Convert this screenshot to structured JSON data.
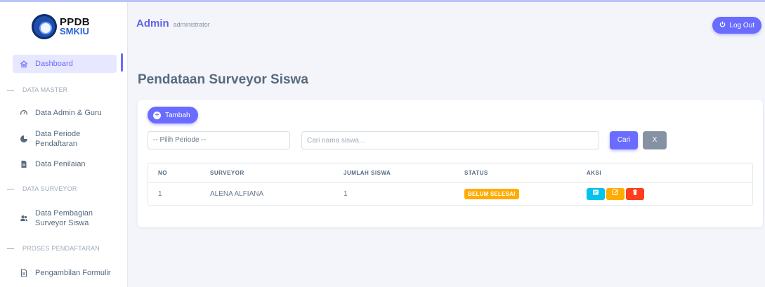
{
  "sidebar": {
    "logo": {
      "line1": "PPDB",
      "line2": "SMKIU"
    },
    "dashboard": {
      "label": "Dashboard",
      "icon": "home-icon"
    },
    "sections": [
      {
        "title": "DATA MASTER"
      },
      {
        "title": "DATA SURVEYOR"
      },
      {
        "title": "PROSES PENDAFTARAN"
      }
    ],
    "items": [
      {
        "label": "Data Admin & Guru",
        "icon": "gauge-icon"
      },
      {
        "label": "Data Periode Pendaftaran",
        "icon": "pie-icon"
      },
      {
        "label": "Data Penilaian",
        "icon": "document-icon"
      },
      {
        "label": "Data Pembagian Surveyor Siswa",
        "icon": "users-icon"
      },
      {
        "label": "Pengambilan Formulir",
        "icon": "file-icon"
      }
    ]
  },
  "topbar": {
    "title": "Admin",
    "role": "administrator",
    "logout_label": "Log Out"
  },
  "page": {
    "title": "Pendataan Surveyor Siswa"
  },
  "toolbar": {
    "add_label": "Tambah",
    "period_select": "-- Pilih Periode --",
    "search_placeholder": "Cari nama siswa...",
    "search_label": "Cari",
    "clear_label": "X"
  },
  "table": {
    "headers": [
      "NO",
      "SURVEYOR",
      "JUMLAH SISWA",
      "STATUS",
      "AKSI"
    ],
    "rows": [
      {
        "no": "1",
        "surveyor": "ALENA ALFIANA",
        "jumlah": "1",
        "status": "BELUM SELESAI"
      }
    ]
  },
  "colors": {
    "primary": "#696cff",
    "warning": "#ffab00",
    "info": "#03c3ec",
    "danger": "#ff3e1d",
    "secondary": "#8592a3"
  }
}
